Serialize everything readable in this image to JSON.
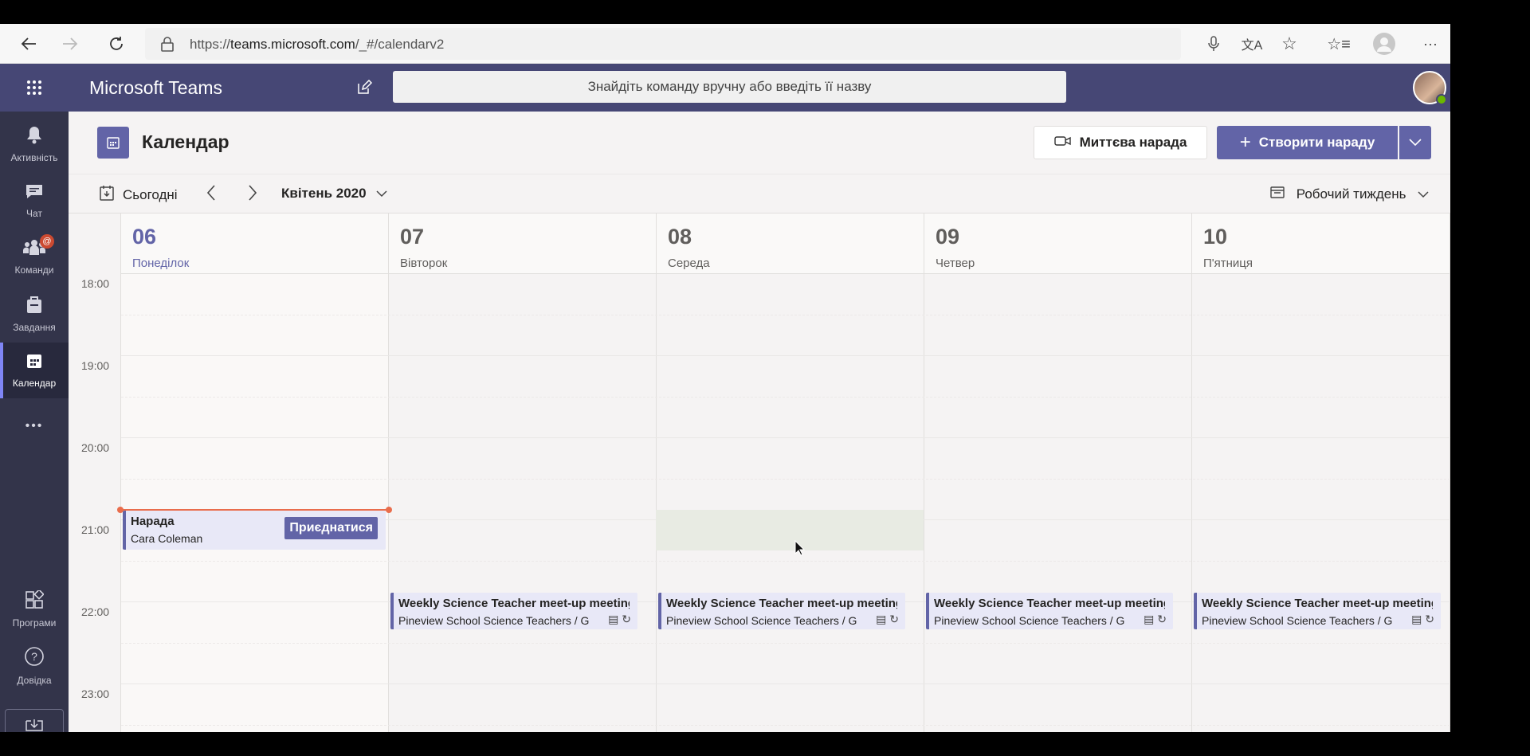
{
  "browser": {
    "url_prefix": "https://",
    "url_host": "teams.microsoft.com",
    "url_path": "/_#/calendarv2"
  },
  "header": {
    "app_title": "Microsoft Teams",
    "search_placeholder": "Знайдіть команду вручну або введіть її назву"
  },
  "rail": {
    "items": [
      {
        "label": "Активність",
        "icon": "bell-icon"
      },
      {
        "label": "Чат",
        "icon": "chat-icon"
      },
      {
        "label": "Команди",
        "icon": "teams-icon",
        "badge": "@"
      },
      {
        "label": "Завдання",
        "icon": "assignments-icon"
      },
      {
        "label": "Календар",
        "icon": "calendar-icon"
      },
      {
        "label": "Програми",
        "icon": "apps-icon"
      },
      {
        "label": "Довідка",
        "icon": "help-icon"
      }
    ],
    "more": "•••"
  },
  "calendar": {
    "title": "Календар",
    "meet_now": "Миттєва нарада",
    "new_meeting": "Створити нараду",
    "today": "Сьогодні",
    "month": "Квітень 2020",
    "view": "Робочий тиждень",
    "days": [
      {
        "num": "06",
        "name": "Понеділок"
      },
      {
        "num": "07",
        "name": "Вівторок"
      },
      {
        "num": "08",
        "name": "Середа"
      },
      {
        "num": "09",
        "name": "Четвер"
      },
      {
        "num": "10",
        "name": "П'ятниця"
      }
    ],
    "times": [
      "18:00",
      "19:00",
      "20:00",
      "21:00",
      "22:00",
      "23:00"
    ],
    "events": {
      "meeting": {
        "title": "Нарада",
        "organizer": "Cara Coleman",
        "join": "Приєднатися"
      },
      "weekly_title": "Weekly Science Teacher meet-up meeting",
      "weekly_sub": "Pineview School Science Teachers / G"
    }
  },
  "colors": {
    "accent": "#6264a7",
    "header": "#464775",
    "rail": "#33344a",
    "now_line": "#e96d4c"
  }
}
